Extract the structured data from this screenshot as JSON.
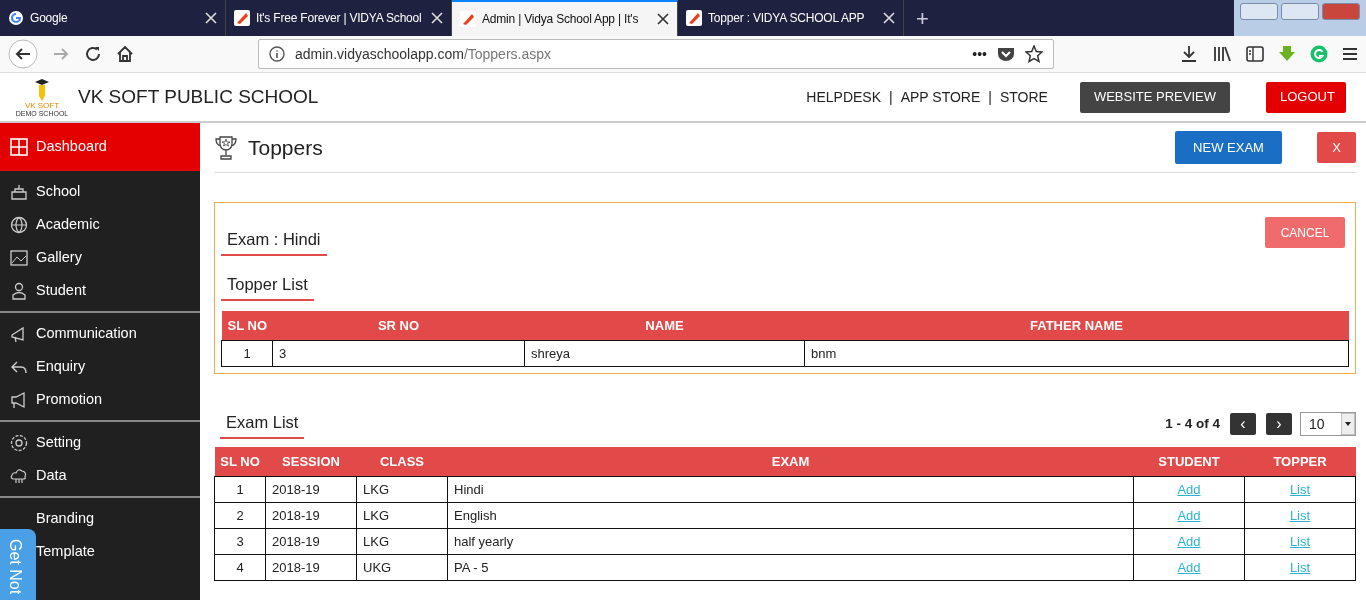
{
  "browser": {
    "tabs": [
      {
        "title": "Google",
        "selected": false
      },
      {
        "title": "It's Free Forever | VIDYA School",
        "selected": false
      },
      {
        "title": "Admin | Vidya School App | It's",
        "selected": true
      },
      {
        "title": "Topper : VIDYA SCHOOL APP",
        "selected": false
      }
    ],
    "new_tab": "+",
    "url_host": "admin.vidyaschoolapp.com",
    "url_path": "/Toppers.aspx",
    "page_actions": "•••"
  },
  "header": {
    "logo_line1": "VK SOFT",
    "logo_line2": "DEMO SCHOOL",
    "school_name": "VK SOFT PUBLIC SCHOOL",
    "links": [
      "HELPDESK",
      "APP STORE",
      "STORE"
    ],
    "separator": "|",
    "preview_button": "WEBSITE PREVIEW",
    "logout_button": "LOGOUT"
  },
  "sidebar": {
    "groups": [
      [
        {
          "label": "Dashboard",
          "selected": true
        }
      ],
      [
        {
          "label": "School",
          "selected": false
        },
        {
          "label": "Academic",
          "selected": false
        },
        {
          "label": "Gallery",
          "selected": false
        },
        {
          "label": "Student",
          "selected": false
        }
      ],
      [
        {
          "label": "Communication",
          "selected": false
        },
        {
          "label": "Enquiry",
          "selected": false
        },
        {
          "label": "Promotion",
          "selected": false
        }
      ],
      [
        {
          "label": "Setting",
          "selected": false
        },
        {
          "label": "Data",
          "selected": false
        }
      ],
      [
        {
          "label": "Branding",
          "selected": false
        },
        {
          "label": "Template",
          "selected": false
        }
      ]
    ]
  },
  "feedback_tab": "Get Not",
  "page": {
    "title": "Toppers",
    "new_exam_button": "NEW EXAM",
    "close_button": "X"
  },
  "topper_panel": {
    "exam_heading": "Exam : Hindi",
    "cancel_button": "CANCEL",
    "list_heading": "Topper List",
    "columns": [
      "SL NO",
      "SR NO",
      "NAME",
      "FATHER NAME"
    ],
    "rows": [
      [
        "1",
        "3",
        "shreya",
        "bnm"
      ]
    ]
  },
  "exam_list": {
    "heading": "Exam List",
    "range": "1 - 4 of 4",
    "prev": "‹",
    "next": "›",
    "page_size": "10",
    "columns": [
      "SL NO",
      "SESSION",
      "CLASS",
      "EXAM",
      "STUDENT",
      "TOPPER"
    ],
    "rows": [
      {
        "sl": "1",
        "session": "2018-19",
        "class": "LKG",
        "exam": "Hindi",
        "student": "Add",
        "topper": "List"
      },
      {
        "sl": "2",
        "session": "2018-19",
        "class": "LKG",
        "exam": "English",
        "student": "Add",
        "topper": "List"
      },
      {
        "sl": "3",
        "session": "2018-19",
        "class": "LKG",
        "exam": "half yearly",
        "student": "Add",
        "topper": "List"
      },
      {
        "sl": "4",
        "session": "2018-19",
        "class": "UKG",
        "exam": "PA - 5",
        "student": "Add",
        "topper": "List"
      }
    ]
  }
}
